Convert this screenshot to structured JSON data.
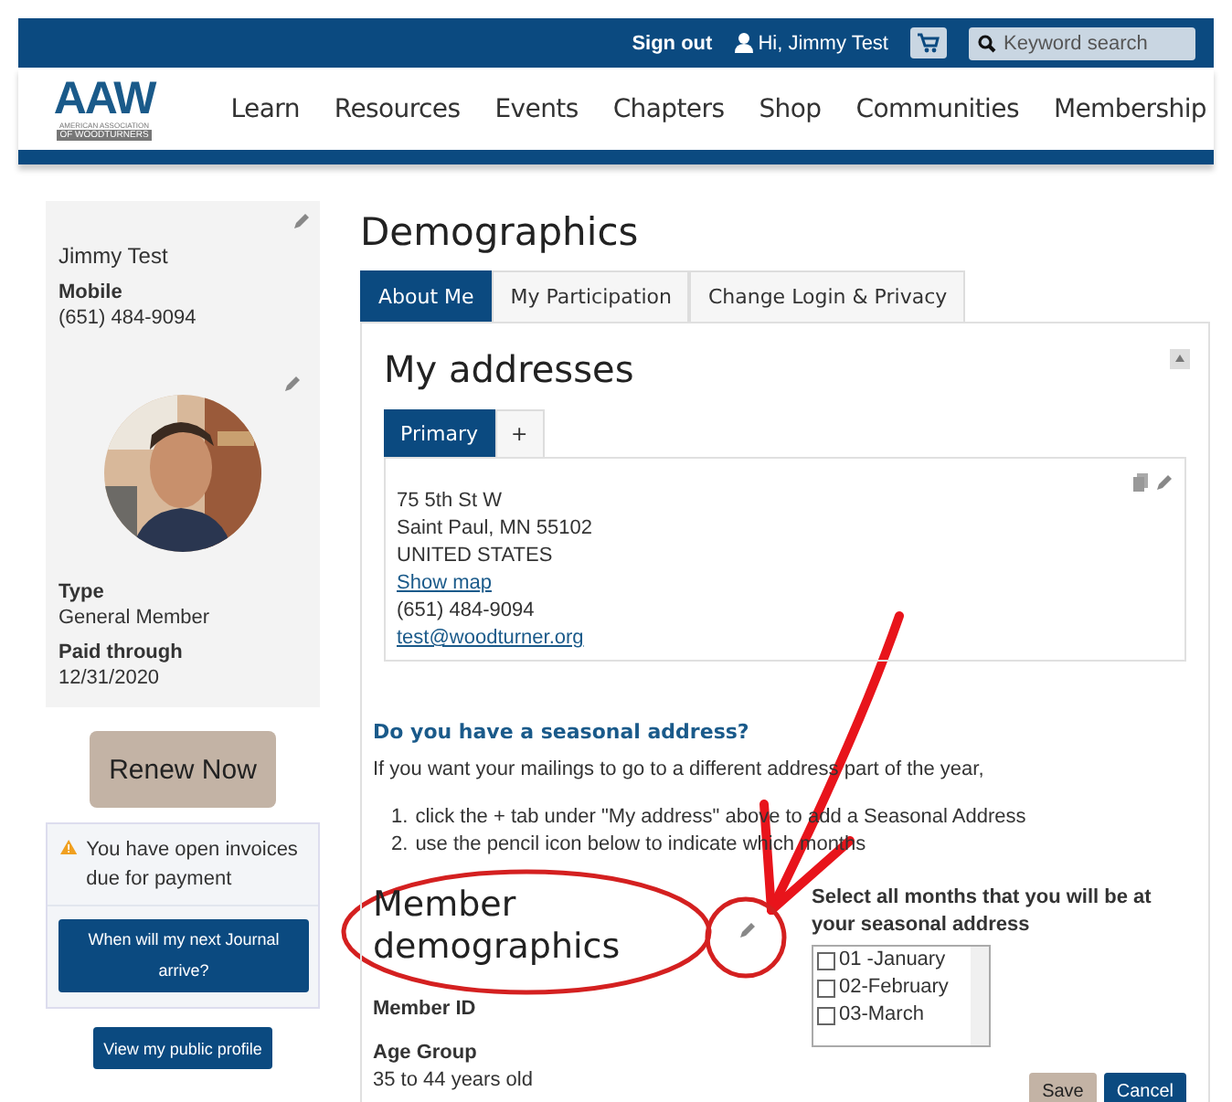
{
  "top_bar": {
    "sign_out": "Sign out",
    "greeting": "Hi, Jimmy Test",
    "search": {
      "placeholder": "Keyword search"
    }
  },
  "logo": {
    "text": "AAW",
    "subtitle_1": "AMERICAN ASSOCIATION",
    "subtitle_2": "OF WOODTURNERS"
  },
  "nav": [
    "Learn",
    "Resources",
    "Events",
    "Chapters",
    "Shop",
    "Communities",
    "Membership"
  ],
  "profile": {
    "name": "Jimmy Test",
    "mobile_label": "Mobile",
    "mobile": "(651) 484-9094",
    "type_label": "Type",
    "type": "General Member",
    "paid_label": "Paid through",
    "paid": "12/31/2020"
  },
  "renew_button": "Renew Now",
  "notice": {
    "text": "You have open invoices due for payment",
    "button": "When will my next Journal arrive?"
  },
  "public_profile_button": "View my public profile",
  "page_title": "Demographics",
  "tabs": [
    {
      "label": "About Me",
      "selected": true
    },
    {
      "label": "My Participation",
      "selected": false
    },
    {
      "label": "Change Login & Privacy",
      "selected": false
    }
  ],
  "addresses": {
    "title": "My addresses",
    "tabs": [
      {
        "label": "Primary",
        "selected": true
      },
      {
        "label": "+",
        "selected": false
      }
    ],
    "lines": [
      "75 5th St W",
      "Saint Paul, MN 55102",
      "UNITED STATES"
    ],
    "map_link": "Show map",
    "phone": "(651) 484-9094",
    "email": "test@woodturner.org"
  },
  "seasonal": {
    "heading": "Do you have a seasonal address?",
    "intro": "If you want your mailings to go to a different address part of the year,",
    "steps": [
      {
        "marker": "1.",
        "text": "click the + tab under \"My address\" above to add a Seasonal Address"
      },
      {
        "marker": "2.",
        "text": "use the pencil icon below to indicate which months"
      }
    ]
  },
  "demographics": {
    "title": "Member demographics",
    "fields": [
      {
        "label": "Member ID"
      },
      {
        "label": "Age Group",
        "value": "35 to 44 years old"
      }
    ]
  },
  "months": {
    "prompt": "Select all months that you will be at your seasonal address",
    "options": [
      {
        "label": "01 -January",
        "checked": false
      },
      {
        "label": "02-February",
        "checked": false
      },
      {
        "label": "03-March",
        "checked": false
      }
    ]
  },
  "buttons": [
    {
      "label": "Save",
      "kind": "secondary"
    },
    {
      "label": "Cancel",
      "kind": "primary"
    }
  ]
}
